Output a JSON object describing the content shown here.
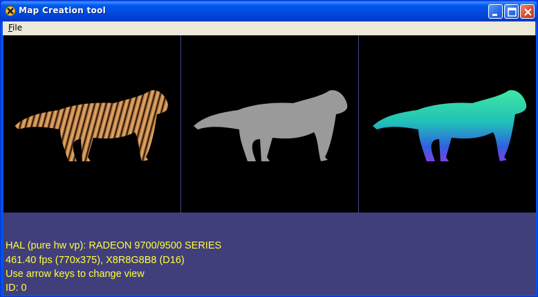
{
  "window": {
    "title": "Map Creation tool"
  },
  "menu": {
    "file_prefix": "",
    "file_mnemonic": "F",
    "file_rest": "ile"
  },
  "views": [
    {
      "name": "textured"
    },
    {
      "name": "height-map"
    },
    {
      "name": "normal-map"
    }
  ],
  "info": {
    "line1": "HAL (pure hw vp): RADEON 9700/9500 SERIES",
    "line2": "461.40 fps (770x375), X8R8G8B8 (D16)",
    "line3": "Use arrow keys to change view",
    "line4": "ID: 0"
  },
  "colors": {
    "info_text": "#ffff3c",
    "info_bg": "#413f7b",
    "viewport_bg": "#000000"
  }
}
